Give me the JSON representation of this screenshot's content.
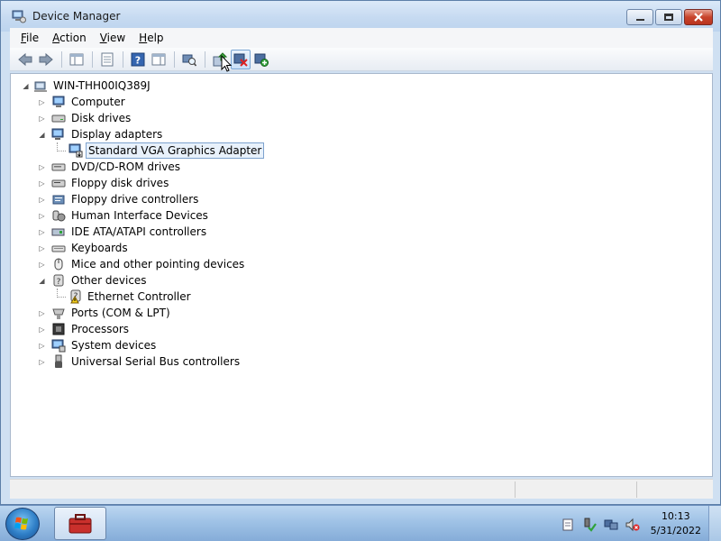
{
  "window": {
    "title": "Device Manager",
    "icon": "device-manager-icon",
    "caption_buttons": [
      "minimize-icon",
      "restore-icon",
      "close-icon"
    ]
  },
  "menu": {
    "items": [
      {
        "label": "File",
        "mnemonic": "F",
        "rest": "ile"
      },
      {
        "label": "Action",
        "mnemonic": "A",
        "rest": "ction"
      },
      {
        "label": "View",
        "mnemonic": "V",
        "rest": "iew"
      },
      {
        "label": "Help",
        "mnemonic": "H",
        "rest": "elp"
      }
    ]
  },
  "toolbar": {
    "buttons": [
      "back-icon",
      "forward-icon",
      "show-hide-tree-icon",
      "properties-icon",
      "help-icon",
      "show-hide-action-pane-icon",
      "scan-hardware-icon",
      "update-driver-icon",
      "uninstall-icon",
      "enable-device-icon"
    ]
  },
  "tree": {
    "root": "WIN-THH00IQ389J",
    "nodes": [
      {
        "label": "Computer",
        "icon": "computer-icon",
        "expanded": false,
        "level": 1
      },
      {
        "label": "Disk drives",
        "icon": "disk-drive-icon",
        "expanded": false,
        "level": 1
      },
      {
        "label": "Display adapters",
        "icon": "display-adapter-icon",
        "expanded": true,
        "level": 1
      },
      {
        "label": "Standard VGA Graphics Adapter",
        "icon": "display-adapter-device-icon",
        "level": 2,
        "selected": true
      },
      {
        "label": "DVD/CD-ROM drives",
        "icon": "dvd-drive-icon",
        "expanded": false,
        "level": 1
      },
      {
        "label": "Floppy disk drives",
        "icon": "floppy-drive-icon",
        "expanded": false,
        "level": 1
      },
      {
        "label": "Floppy drive controllers",
        "icon": "floppy-controller-icon",
        "expanded": false,
        "level": 1
      },
      {
        "label": "Human Interface Devices",
        "icon": "hid-icon",
        "expanded": false,
        "level": 1
      },
      {
        "label": "IDE ATA/ATAPI controllers",
        "icon": "ide-controller-icon",
        "expanded": false,
        "level": 1
      },
      {
        "label": "Keyboards",
        "icon": "keyboard-icon",
        "expanded": false,
        "level": 1
      },
      {
        "label": "Mice and other pointing devices",
        "icon": "mouse-icon",
        "expanded": false,
        "level": 1
      },
      {
        "label": "Other devices",
        "icon": "other-devices-icon",
        "expanded": true,
        "level": 1
      },
      {
        "label": "Ethernet Controller",
        "icon": "unknown-device-warning-icon",
        "level": 2
      },
      {
        "label": "Ports (COM & LPT)",
        "icon": "port-icon",
        "expanded": false,
        "level": 1
      },
      {
        "label": "Processors",
        "icon": "processor-icon",
        "expanded": false,
        "level": 1
      },
      {
        "label": "System devices",
        "icon": "system-devices-icon",
        "expanded": false,
        "level": 1
      },
      {
        "label": "Universal Serial Bus controllers",
        "icon": "usb-icon",
        "expanded": false,
        "level": 1
      }
    ]
  },
  "taskbar": {
    "start": "windows-start-orb-icon",
    "task": "device-manager-task-icon",
    "tray": [
      "action-center-icon",
      "safely-remove-hardware-icon",
      "network-icon",
      "volume-muted-icon"
    ],
    "time": "10:13",
    "date": "5/31/2022"
  },
  "colors": {
    "title_gradient_top": "#dbe9f8",
    "selection_border": "#7da2ce",
    "selection_fill": "#e8f1fb",
    "taskbar": "#9fc2e6"
  }
}
